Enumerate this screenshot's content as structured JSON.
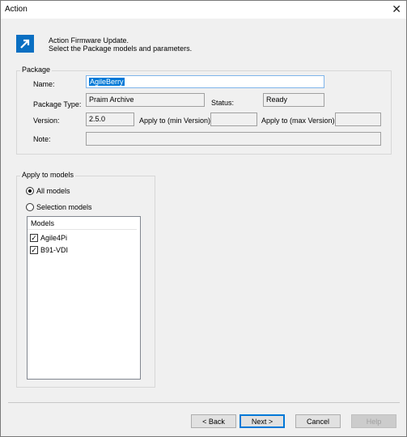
{
  "window": {
    "title": "Action"
  },
  "header": {
    "line1": "Action Firmware Update.",
    "line2": "Select the Package models and parameters."
  },
  "package": {
    "legend": "Package",
    "name_label": "Name:",
    "name_value": "AgileBerry",
    "type_label": "Package Type:",
    "type_value": "Praim Archive",
    "status_label": "Status:",
    "status_value": "Ready",
    "version_label": "Version:",
    "version_value": "2.5.0",
    "min_version_label": "Apply to (min Version):",
    "min_version_value": "",
    "max_version_label": "Apply to (max Version):",
    "max_version_value": "",
    "note_label": "Note:",
    "note_value": ""
  },
  "apply": {
    "legend": "Apply to models",
    "all_models_label": "All models",
    "selection_models_label": "Selection models",
    "list_header": "Models",
    "models": [
      {
        "label": "Agile4Pi",
        "checked": true
      },
      {
        "label": "B91-VDI",
        "checked": true
      }
    ]
  },
  "buttons": {
    "back": "< Back",
    "next": "Next >",
    "cancel": "Cancel",
    "help": "Help"
  }
}
